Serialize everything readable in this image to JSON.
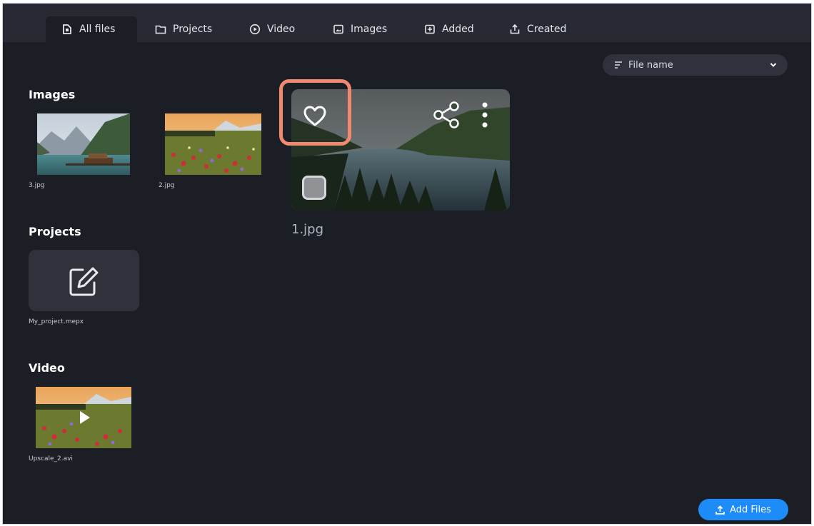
{
  "tabs": [
    {
      "label": "All files",
      "icon": "all-files-icon",
      "active": true
    },
    {
      "label": "Projects",
      "icon": "folder-icon",
      "active": false
    },
    {
      "label": "Video",
      "icon": "play-circle-icon",
      "active": false
    },
    {
      "label": "Images",
      "icon": "image-icon",
      "active": false
    },
    {
      "label": "Added",
      "icon": "added-icon",
      "active": false
    },
    {
      "label": "Created",
      "icon": "export-icon",
      "active": false
    }
  ],
  "sort": {
    "label": "File name",
    "icon": "sort-icon",
    "dropdown_icon": "chevron-down-icon"
  },
  "sections": {
    "images": {
      "title": "Images",
      "items": [
        {
          "name": "3.jpg",
          "scene": "mountain-lake-cabin"
        },
        {
          "name": "2.jpg",
          "scene": "wildflower-meadow"
        }
      ]
    },
    "projects": {
      "title": "Projects",
      "items": [
        {
          "name": "My_project.mepx",
          "icon": "edit-icon"
        }
      ]
    },
    "video": {
      "title": "Video",
      "items": [
        {
          "name": "Upscale_2.avi",
          "icon": "play-icon"
        }
      ]
    }
  },
  "preview": {
    "name": "1.jpg",
    "icons": [
      "heart-icon",
      "share-icon",
      "more-vertical-icon"
    ],
    "highlight_color": "#f0896f"
  },
  "add_button": {
    "label": "Add Files",
    "icon": "upload-icon"
  },
  "colors": {
    "background": "#1c1e26",
    "tabbar": "#272a33",
    "accent": "#1d8cf8",
    "text": "#e3e6ec"
  }
}
